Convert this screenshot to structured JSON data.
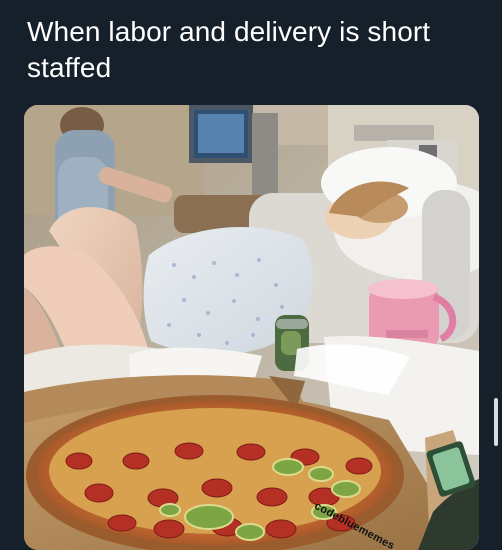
{
  "post": {
    "caption": "When labor and delivery is short staffed"
  },
  "photo": {
    "watermark": "codeblue​memes"
  },
  "colors": {
    "background": "#15202b",
    "caption_text": "#ffffff"
  }
}
